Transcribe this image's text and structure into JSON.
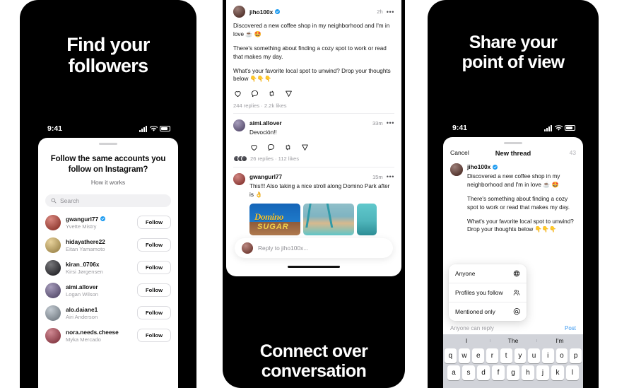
{
  "panels": {
    "left": {
      "headline_line1": "Find your",
      "headline_line2": "followers",
      "status": {
        "time": "9:41"
      },
      "sheet": {
        "title": "Follow the same accounts you follow on Instagram?",
        "subtitle": "How it works",
        "search_placeholder": "Search",
        "follow_label": "Follow",
        "accounts": [
          {
            "username": "gwangurl77",
            "name": "Yvette Mistry",
            "verified": true,
            "avatar": "#c0392b"
          },
          {
            "username": "hidayathere22",
            "name": "Eitan Yamamoto",
            "verified": false,
            "avatar": "#d8b45a"
          },
          {
            "username": "kiran_0706x",
            "name": "Kirsi Jørgensen",
            "verified": false,
            "avatar": "#1c1c22"
          },
          {
            "username": "aimi.allover",
            "name": "Logan Wilson",
            "verified": false,
            "avatar": "#6b5b8e"
          },
          {
            "username": "alo.daiane1",
            "name": "Airi Anderson",
            "verified": false,
            "avatar": "#9aa7b3"
          },
          {
            "username": "nora.needs.cheese",
            "name": "Myka Mercado",
            "verified": false,
            "avatar": "#b03a4a"
          }
        ]
      }
    },
    "middle": {
      "caption_line1": "Connect over",
      "caption_line2": "conversation",
      "post": {
        "username": "jiho100x",
        "verified": true,
        "timestamp": "2h",
        "more": "•••",
        "paragraphs": [
          "Discovered a new coffee shop in my neighborhood and I'm in love ☕ 🤩",
          "There's something about finding a cozy spot to work or read that makes my day.",
          "What's your favorite local spot to unwind? Drop your thoughts below 👇👇👇"
        ],
        "meta": "244 replies · 2.2k likes"
      },
      "comments": [
        {
          "username": "aimi.allover",
          "timestamp": "33m",
          "text": "Devoción!!",
          "meta": "26 replies · 112 likes",
          "has_actions": true,
          "has_facepile": true,
          "has_thumbs": false
        },
        {
          "username": "gwangurl77",
          "timestamp": "15m",
          "text": "This!!! Also taking a nice stroll along Domino Park after is 👌",
          "meta": "",
          "has_actions": false,
          "has_facepile": false,
          "has_thumbs": true
        }
      ],
      "thumbnails": [
        {
          "label_main": "Domino",
          "label_sub": "SUGAR"
        },
        {
          "label_main": "",
          "label_sub": ""
        },
        {
          "label_main": "",
          "label_sub": ""
        }
      ],
      "reply_placeholder": "Reply to jiho100x..."
    },
    "right": {
      "headline_line1": "Share your",
      "headline_line2": "point of view",
      "status": {
        "time": "9:41"
      },
      "navbar": {
        "cancel": "Cancel",
        "title": "New thread",
        "count": "43"
      },
      "compose": {
        "username": "jiho100x",
        "verified": true,
        "paragraphs": [
          "Discovered a new coffee shop in my neighborhood and I'm in love ☕ 🤩",
          "There's something about finding a cozy spot to work or read that makes my day.",
          "What's your favorite local spot to unwind?Drop your thoughts below 👇👇👇"
        ]
      },
      "audience_menu": [
        {
          "label": "Anyone",
          "icon": "globe-icon"
        },
        {
          "label": "Profiles you follow",
          "icon": "people-icon"
        },
        {
          "label": "Mentioned only",
          "icon": "at-icon"
        }
      ],
      "reply_note": "Anyone can reply",
      "post_button": "Post",
      "keyboard": {
        "predictions": [
          "I",
          "The",
          "I'm"
        ],
        "row1": [
          "q",
          "w",
          "e",
          "r",
          "t",
          "y",
          "u",
          "i",
          "o",
          "p"
        ],
        "row2": [
          "a",
          "s",
          "d",
          "f",
          "g",
          "h",
          "j",
          "k",
          "l"
        ]
      }
    }
  },
  "colors": {
    "accent_blue": "#3897f0",
    "verified_blue": "#1d9bf0",
    "background_black": "#000000",
    "sheet_white": "#ffffff"
  }
}
